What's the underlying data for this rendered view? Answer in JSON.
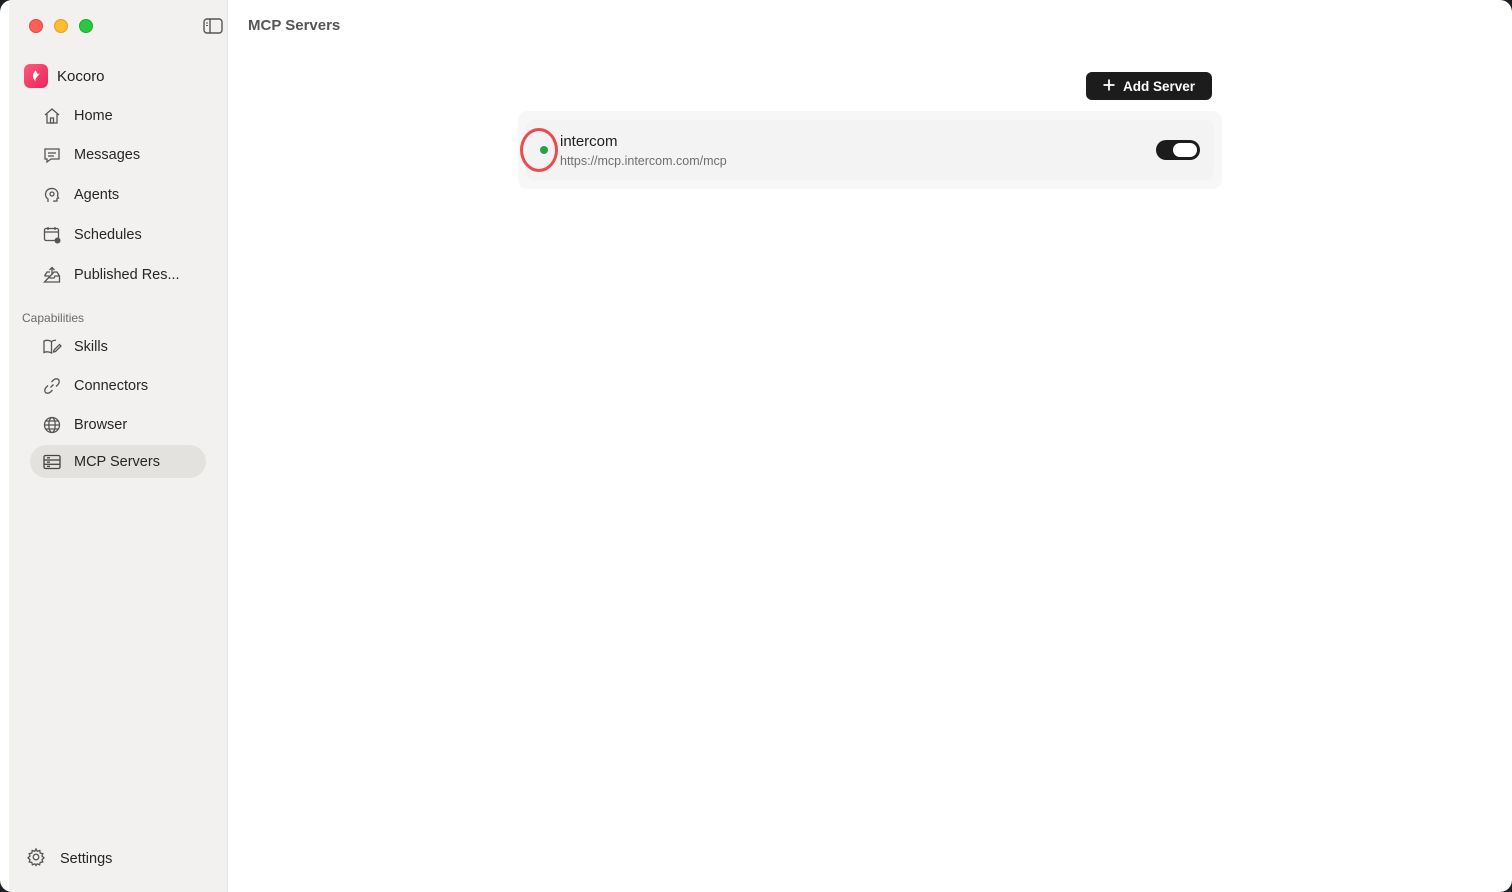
{
  "app": {
    "name": "Kocoro",
    "page_title": "MCP Servers"
  },
  "sidebar": {
    "nav": [
      {
        "label": "Home",
        "icon": "home-icon"
      },
      {
        "label": "Messages",
        "icon": "messages-icon"
      },
      {
        "label": "Agents",
        "icon": "agents-icon"
      },
      {
        "label": "Schedules",
        "icon": "schedules-icon"
      },
      {
        "label": "Published Res...",
        "icon": "published-icon"
      }
    ],
    "section_label": "Capabilities",
    "capabilities": [
      {
        "label": "Skills",
        "icon": "skills-icon"
      },
      {
        "label": "Connectors",
        "icon": "link-icon"
      },
      {
        "label": "Browser",
        "icon": "globe-icon"
      },
      {
        "label": "MCP Servers",
        "icon": "server-icon",
        "active": true
      }
    ],
    "settings_label": "Settings"
  },
  "main": {
    "add_button_label": "Add Server",
    "servers": [
      {
        "name": "intercom",
        "url": "https://mcp.intercom.com/mcp",
        "status": "connected",
        "status_color": "#26a34a",
        "enabled": true
      }
    ]
  }
}
